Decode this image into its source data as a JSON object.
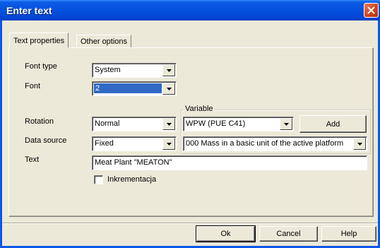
{
  "window": {
    "title": "Enter text"
  },
  "tabs": [
    {
      "label": "Text properties",
      "active": true
    },
    {
      "label": "Other options",
      "active": false
    }
  ],
  "form": {
    "font_type": {
      "label": "Font type",
      "value": "System"
    },
    "font": {
      "label": "Font",
      "value": "2"
    },
    "rotation": {
      "label": "Rotation",
      "value": "Normal"
    },
    "data_source": {
      "label": "Data source",
      "value": "Fixed"
    },
    "text": {
      "label": "Text",
      "value": "Meat Plant \"MEATON\""
    },
    "increment": {
      "label": "Inkrementacja",
      "checked": false
    }
  },
  "variable": {
    "legend": "Variable",
    "source": "WPW (PUE C41)",
    "add_label": "Add",
    "item": "000 Mass in a basic unit of the active platform"
  },
  "footer": {
    "ok": "Ok",
    "cancel": "Cancel",
    "help": "Help"
  },
  "colors": {
    "titlebar": "#0651dd",
    "face": "#ece9d8",
    "selection": "#316ac5"
  }
}
